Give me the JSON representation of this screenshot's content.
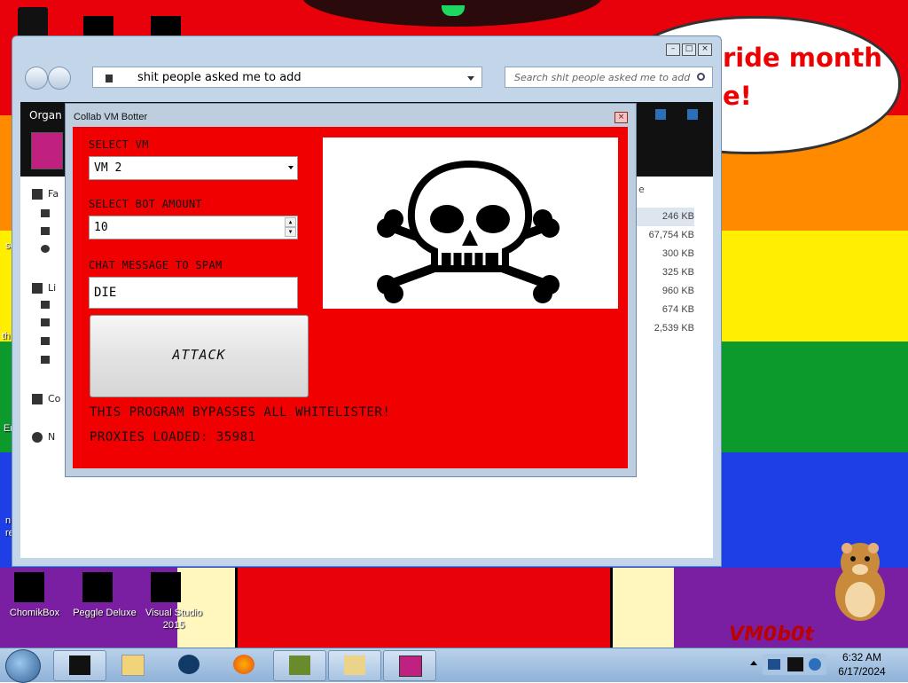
{
  "desktop": {
    "speech_text": "ride month\ne!",
    "icons": [
      {
        "label": "ChomikBox"
      },
      {
        "label": "Peggle Deluxe"
      },
      {
        "label": "Visual Studio\n2015"
      }
    ],
    "watermark": "VM0b0t"
  },
  "explorer": {
    "address": "shit people asked me to add",
    "search_placeholder": "Search shit people asked me to add",
    "toolbar_label": "Organ",
    "sidebar": [
      "Fa",
      "Li",
      "Co",
      "N"
    ],
    "file_sizes": [
      "246 KB",
      "67,754 KB",
      "300 KB",
      "325 KB",
      "960 KB",
      "674 KB",
      "2,539 KB"
    ],
    "column_fragment": "e",
    "left_edge_fragments": [
      "sc",
      "th",
      "Er",
      "n\nre"
    ]
  },
  "botter": {
    "title": "Collab VM Botter",
    "select_vm_label": "SELECT VM",
    "vm_value": "VM 2",
    "bot_amount_label": "SELECT BOT AMOUNT",
    "bot_amount_value": "10",
    "chat_label": "CHAT MESSAGE TO SPAM",
    "chat_value": "DIE",
    "attack_label": "ATTACK",
    "note1": "THIS PROGRAM BYPASSES ALL WHITELISTER!",
    "note2": "PROXIES LOADED: 35981",
    "image_icon": "skull-and-crossbones"
  },
  "taskbar": {
    "time": "6:32 AM",
    "date": "6/17/2024"
  },
  "colors": {
    "panel_red": "#f00000",
    "accent_red": "#e00000"
  }
}
